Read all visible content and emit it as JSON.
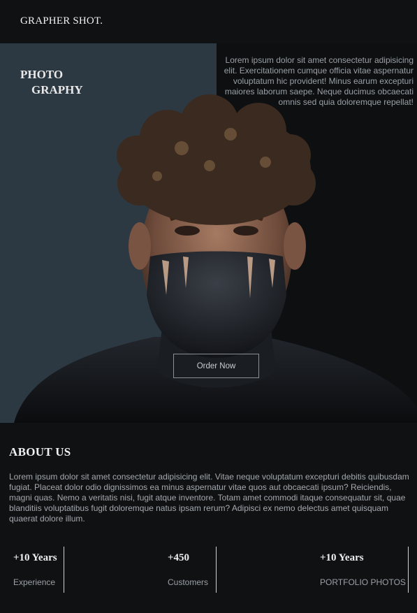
{
  "header": {
    "brand": "GRAPHER SHOT."
  },
  "hero": {
    "title_line1": "PHOTO",
    "title_line2": "GRAPHY",
    "description": "Lorem ipsum dolor sit amet consectetur adipisicing elit. Exercitationem cumque officia vitae aspernatur voluptatum hic provident! Minus earum excepturi maiores laborum saepe. Neque ducimus obcaecati omnis sed quia doloremque repellat!",
    "order_button": "Order Now",
    "image": "portrait-photo"
  },
  "about": {
    "title": "ABOUT US",
    "text": "Lorem ipsum dolor sit amet consectetur adipisicing elit. Vitae neque voluptatum excepturi debitis quibusdam fugiat. Placeat dolor odio dignissimos ea minus aspernatur vitae quos aut obcaecati ipsum? Reiciendis, magni quas. Nemo a veritatis nisi, fugit atque inventore. Totam amet commodi itaque consequatur sit, quae blanditiis voluptatibus fugit doloremque natus ipsam rerum? Adipisci ex nemo delectus amet quisquam quaerat dolore illum."
  },
  "stats": [
    {
      "value": "+10 Years",
      "label": "Experience"
    },
    {
      "value": "+450",
      "label": "Customers"
    },
    {
      "value": "+10 Years",
      "label": "PORTFOLIO PHOTOS"
    }
  ],
  "colors": {
    "background": "#0f1113",
    "panel": "#2c3943"
  }
}
